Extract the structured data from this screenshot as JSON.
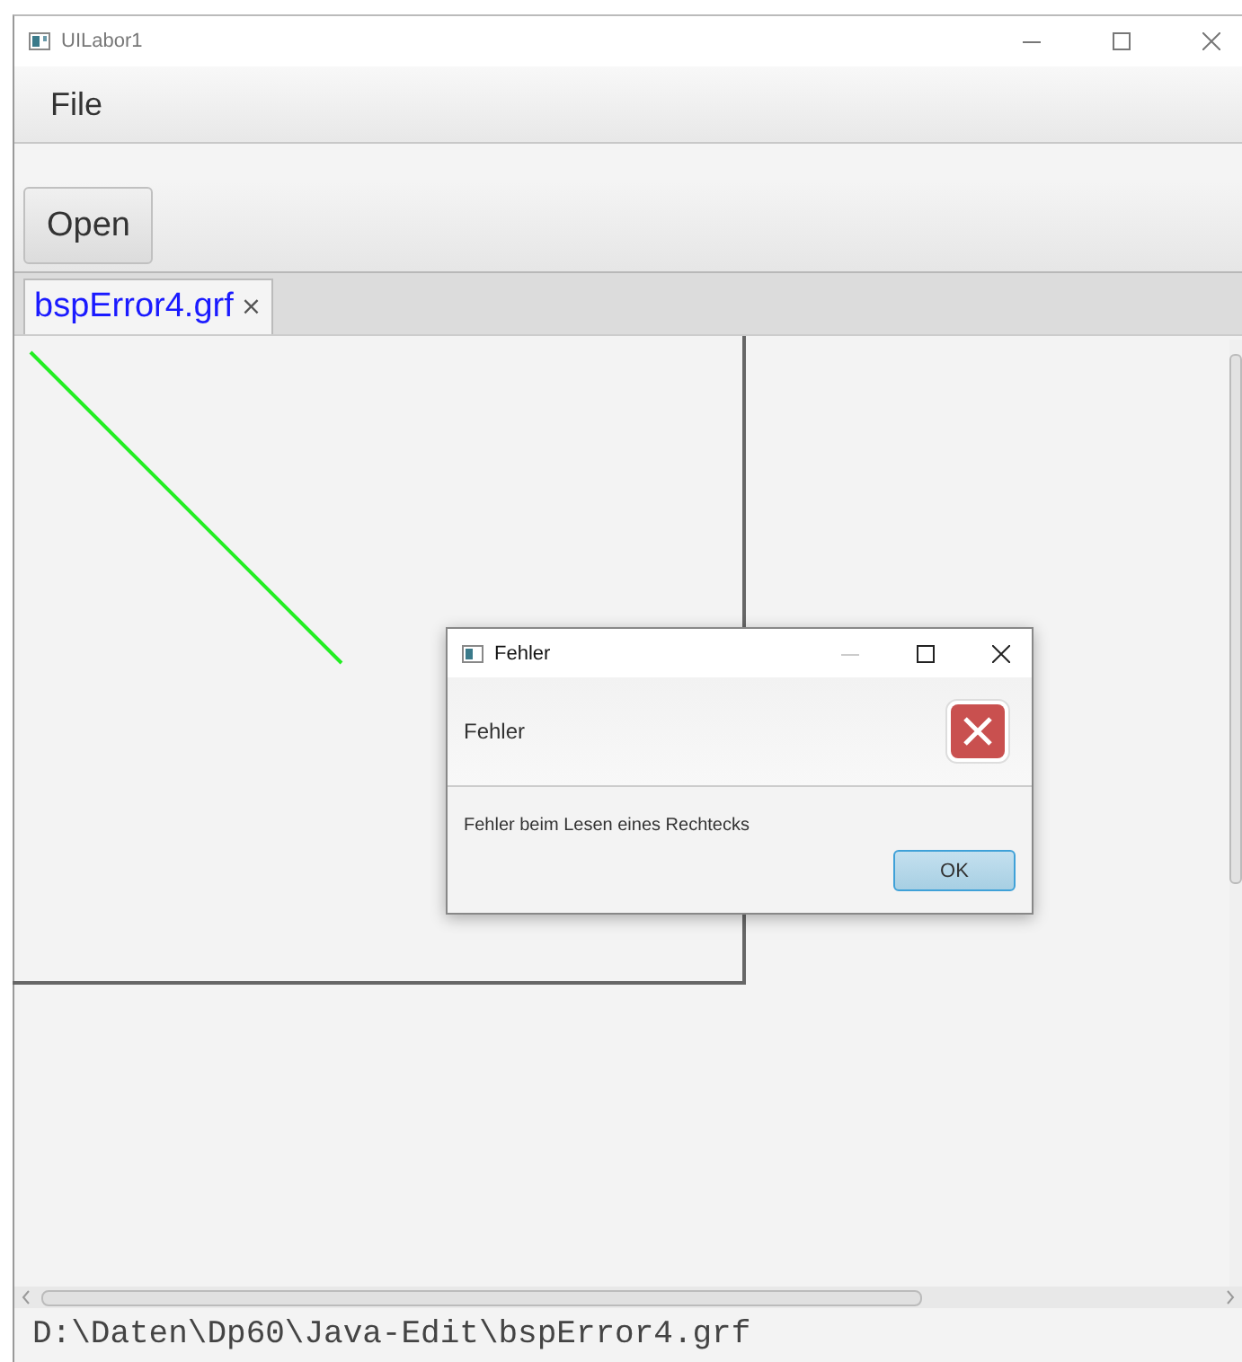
{
  "window": {
    "title": "UILabor1"
  },
  "menu": [
    "File"
  ],
  "toolbar": [
    "Open"
  ],
  "tabs": [
    {
      "label": "bspError4.grf",
      "close": "×",
      "selected": true
    }
  ],
  "dialog": {
    "title": "Fehler",
    "header": "Fehler",
    "message": "Fehler beim Lesen eines Rechtecks",
    "buttons": [
      "OK"
    ]
  },
  "status_bar": "D:\\Daten\\Dp60\\Java-Edit\\bspError4.grf"
}
